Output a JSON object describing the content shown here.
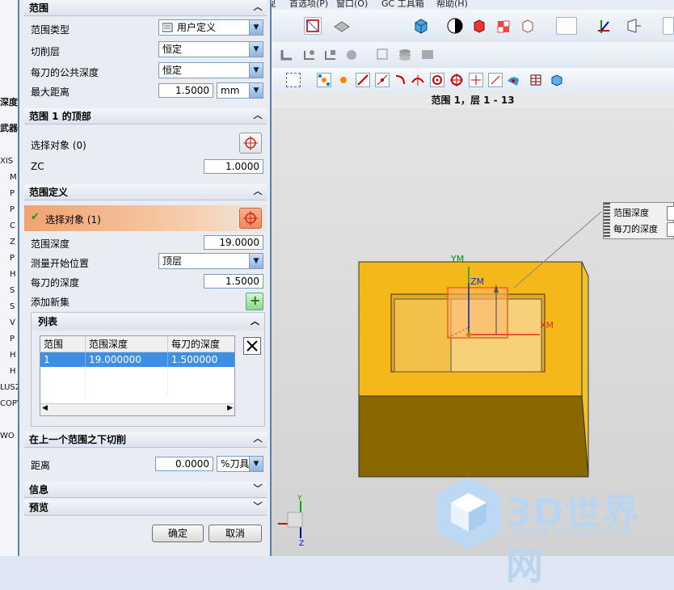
{
  "menubar": {
    "items": [
      "视",
      "首选项(P)",
      "窗口(O)",
      "GC 工具箱",
      "帮助(H)"
    ]
  },
  "left_strip": {
    "items": [
      "深度",
      "武器",
      "XIS",
      "M",
      "P",
      "P",
      "C",
      "Z",
      "P",
      "H",
      "S",
      "S",
      "V",
      "P",
      "H",
      "H",
      "LUS2",
      "COPY",
      "WO"
    ]
  },
  "viewport": {
    "title": "范围 1，层 1 - 13",
    "callout": {
      "label1": "范围深度",
      "label2": "每刀的深度"
    },
    "axes": {
      "ym": "YM",
      "zm": "ZM",
      "xm": "XM"
    },
    "triad": {
      "y": "Y",
      "z": "Z"
    }
  },
  "dialog": {
    "sec_range": {
      "title": "范围"
    },
    "range_type": {
      "label": "范围类型",
      "value": "用户定义"
    },
    "cut_layer": {
      "label": "切削层",
      "value": "恒定"
    },
    "common_depth": {
      "label": "每刀的公共深度",
      "value": "恒定"
    },
    "max_dist": {
      "label": "最大距离",
      "value": "1.5000",
      "unit": "mm"
    },
    "sec_top": {
      "title": "范围 1 的顶部"
    },
    "select_obj_top": {
      "label": "选择对象 (0)"
    },
    "zc": {
      "label": "ZC",
      "value": "1.0000"
    },
    "sec_def": {
      "title": "范围定义"
    },
    "select_obj_def": {
      "label": "选择对象 (1)"
    },
    "range_depth": {
      "label": "范围深度",
      "value": "19.0000"
    },
    "measure_start": {
      "label": "测量开始位置",
      "value": "顶层"
    },
    "depth_per_cut": {
      "label": "每刀的深度",
      "value": "1.5000"
    },
    "add_new_set": {
      "label": "添加新集"
    },
    "list": {
      "title": "列表",
      "headers": [
        "范围",
        "范围深度",
        "每刀的深度"
      ],
      "rows": [
        {
          "c1": "1",
          "c2": "19.000000",
          "c3": "1.500000"
        }
      ]
    },
    "sec_below": {
      "title": "在上一个范围之下切削"
    },
    "distance": {
      "label": "距离",
      "value": "0.0000",
      "unit": "%刀具"
    },
    "sec_info": {
      "title": "信息"
    },
    "sec_preview": {
      "title": "预览"
    },
    "ok": "确定",
    "cancel": "取消"
  },
  "watermark": {
    "text": "3D世界网",
    "url": "WWW.3DSJW.COM"
  },
  "colors": {
    "accent": "#316ac5",
    "part_top": "#f5b81a",
    "part_side": "#8a6700",
    "select_row": "#3d8ee6"
  }
}
